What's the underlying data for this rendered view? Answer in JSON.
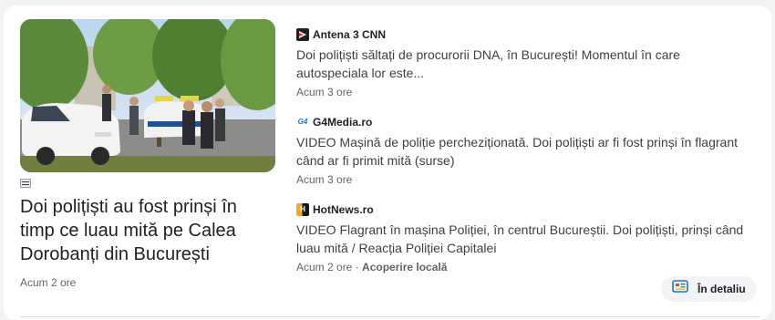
{
  "hero": {
    "image_alt": "Police car and officers on a Bucharest street",
    "title": "Doi polițiști au fost prinși în timp ce luau mită pe Calea Dorobanți din București",
    "time": "Acum 2 ore"
  },
  "stories": [
    {
      "source": "Antena 3 CNN",
      "logo_icon": "antena3-logo-icon",
      "headline": "Doi polițiști săltați de procurorii DNA, în București! Momentul în care autospeciala lor este...",
      "time": "Acum 3 ore"
    },
    {
      "source": "G4Media.ro",
      "logo_icon": "g4media-logo-icon",
      "headline": "VIDEO Mașină de poliție percheziționată. Doi polițiști ar fi fost prinși în flagrant când ar fi primit mită (surse)",
      "time": "Acum 3 ore"
    },
    {
      "source": "HotNews.ro",
      "logo_icon": "hotnews-logo-icon",
      "headline": "VIDEO Flagrant în mașina Poliției, în centrul Bucureștii. Doi polițiști, prinși când luau mită / Reacția Poliției Capitalei",
      "time": "Acum 2 ore",
      "tag": "Acoperire locală"
    }
  ],
  "detail_button": {
    "label": "În detaliu",
    "icon": "full-coverage-icon"
  },
  "colors": {
    "google_blue": "#1a73e8",
    "card_bg": "#ffffff",
    "page_bg": "#f1f3f4"
  }
}
